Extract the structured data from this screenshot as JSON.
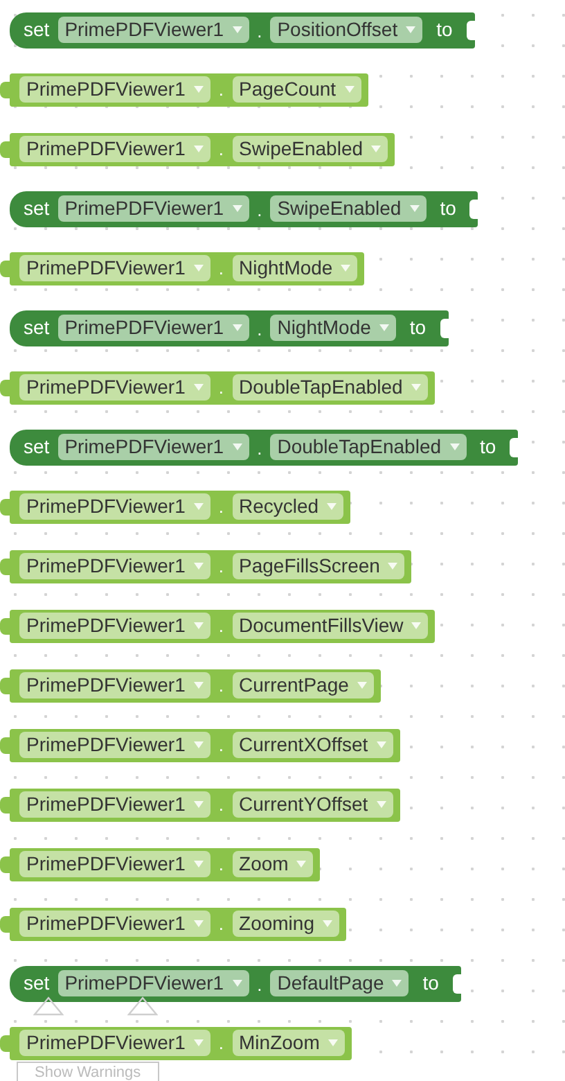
{
  "blocks": [
    {
      "kind": "set",
      "set_label": "set",
      "component": "PrimePDFViewer1",
      "dot": ".",
      "property": "PositionOffset",
      "to_label": "to"
    },
    {
      "kind": "get",
      "component": "PrimePDFViewer1",
      "dot": ".",
      "property": "PageCount"
    },
    {
      "kind": "get",
      "component": "PrimePDFViewer1",
      "dot": ".",
      "property": "SwipeEnabled"
    },
    {
      "kind": "set",
      "set_label": "set",
      "component": "PrimePDFViewer1",
      "dot": ".",
      "property": "SwipeEnabled",
      "to_label": "to"
    },
    {
      "kind": "get",
      "component": "PrimePDFViewer1",
      "dot": ".",
      "property": "NightMode"
    },
    {
      "kind": "set",
      "set_label": "set",
      "component": "PrimePDFViewer1",
      "dot": ".",
      "property": "NightMode",
      "to_label": "to"
    },
    {
      "kind": "get",
      "component": "PrimePDFViewer1",
      "dot": ".",
      "property": "DoubleTapEnabled"
    },
    {
      "kind": "set",
      "set_label": "set",
      "component": "PrimePDFViewer1",
      "dot": ".",
      "property": "DoubleTapEnabled",
      "to_label": "to"
    },
    {
      "kind": "get",
      "component": "PrimePDFViewer1",
      "dot": ".",
      "property": "Recycled"
    },
    {
      "kind": "get",
      "component": "PrimePDFViewer1",
      "dot": ".",
      "property": "PageFillsScreen"
    },
    {
      "kind": "get",
      "component": "PrimePDFViewer1",
      "dot": ".",
      "property": "DocumentFillsView"
    },
    {
      "kind": "get",
      "component": "PrimePDFViewer1",
      "dot": ".",
      "property": "CurrentPage"
    },
    {
      "kind": "get",
      "component": "PrimePDFViewer1",
      "dot": ".",
      "property": "CurrentXOffset"
    },
    {
      "kind": "get",
      "component": "PrimePDFViewer1",
      "dot": ".",
      "property": "CurrentYOffset"
    },
    {
      "kind": "get",
      "component": "PrimePDFViewer1",
      "dot": ".",
      "property": "Zoom"
    },
    {
      "kind": "get",
      "component": "PrimePDFViewer1",
      "dot": ".",
      "property": "Zooming"
    },
    {
      "kind": "set",
      "set_label": "set",
      "component": "PrimePDFViewer1",
      "dot": ".",
      "property": "DefaultPage",
      "to_label": "to"
    },
    {
      "kind": "get",
      "component": "PrimePDFViewer1",
      "dot": ".",
      "property": "MinZoom"
    }
  ],
  "warnings_button": {
    "label": "Show Warnings"
  }
}
